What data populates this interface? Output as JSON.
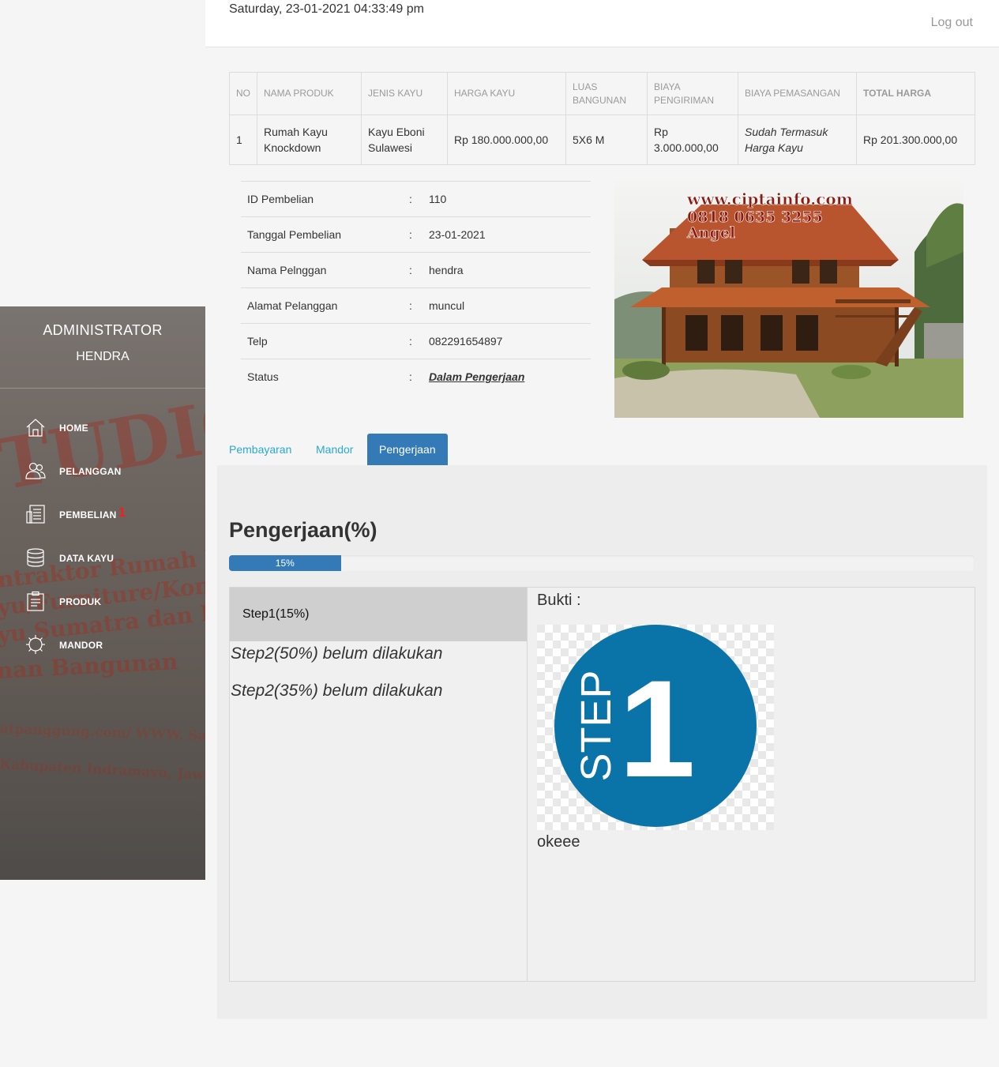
{
  "header": {
    "datetime": "Saturday, 23-01-2021 04:33:49 pm",
    "logout_label": "Log out"
  },
  "sidebar": {
    "role": "ADMINISTRATOR",
    "user": "HENDRA",
    "watermark": [
      "TUDIO OPTI",
      "ntraktor Rumah Kay",
      "yu/Furniture/Kontruksi",
      "yu Sumatra dan Kalima",
      "nan Bangunan",
      "atpanggung.com/ WWW. Salyan-Kont",
      "Kabupaten Indramayu, Jawa Barat"
    ],
    "items": [
      {
        "label": "HOME",
        "icon": "home-icon"
      },
      {
        "label": "PELANGGAN",
        "icon": "users-icon"
      },
      {
        "label": "PEMBELIAN",
        "icon": "receipt-icon",
        "badge": "1"
      },
      {
        "label": "DATA KAYU",
        "icon": "database-icon"
      },
      {
        "label": "PRODUK",
        "icon": "clipboard-icon"
      },
      {
        "label": "MANDOR",
        "icon": "gear-icon"
      }
    ]
  },
  "purchase_table": {
    "headers": [
      "NO",
      "NAMA PRODUK",
      "JENIS KAYU",
      "HARGA KAYU",
      "LUAS BANGUNAN",
      "BIAYA PENGIRIMAN",
      "BIAYA PEMASANGAN",
      "TOTAL HARGA"
    ],
    "rows": [
      [
        "1",
        "Rumah Kayu Knockdown",
        "Kayu Eboni Sulawesi",
        "Rp 180.000.000,00",
        "5X6 M",
        "Rp 3.000.000,00",
        "Sudah Termasuk Harga Kayu",
        "Rp 201.300.000,00"
      ]
    ]
  },
  "details": [
    {
      "key": "ID Pembelian",
      "sep": ":",
      "value": "110"
    },
    {
      "key": "Tanggal Pembelian",
      "sep": ":",
      "value": "23-01-2021"
    },
    {
      "key": "Nama Pelnggan",
      "sep": ":",
      "value": "hendra"
    },
    {
      "key": "Alamat Pelanggan",
      "sep": ":",
      "value": "muncul"
    },
    {
      "key": "Telp",
      "sep": ":",
      "value": "082291654897"
    },
    {
      "key": "Status",
      "sep": ":",
      "value": "Dalam Pengerjaan"
    }
  ],
  "product_image": {
    "line1": "www.ciptainfo.com",
    "line2": "0818 0635 3255",
    "line3": "Angel"
  },
  "tabs": [
    {
      "label": "Pembayaran",
      "active": false
    },
    {
      "label": "Mandor",
      "active": false
    },
    {
      "label": "Pengerjaan",
      "active": true
    }
  ],
  "progress_panel": {
    "title": "Pengerjaan(%)",
    "percent": 15,
    "percent_label": "15%",
    "steps": [
      {
        "label": "Step1(15%)",
        "done": true
      },
      {
        "label": "Step2(50%) belum dilakukan",
        "done": false
      },
      {
        "label": "Step2(35%) belum dilakukan",
        "done": false
      }
    ],
    "bukti_label": "Bukti :",
    "proof_image": {
      "word": "STEP",
      "number": "1",
      "color": "#0a74a8"
    },
    "note": "okeee"
  },
  "colors": {
    "primary": "#337ab7",
    "tab_link": "#29a8d6",
    "badge": "#ff1a1a",
    "step_circle": "#0a74a8"
  }
}
